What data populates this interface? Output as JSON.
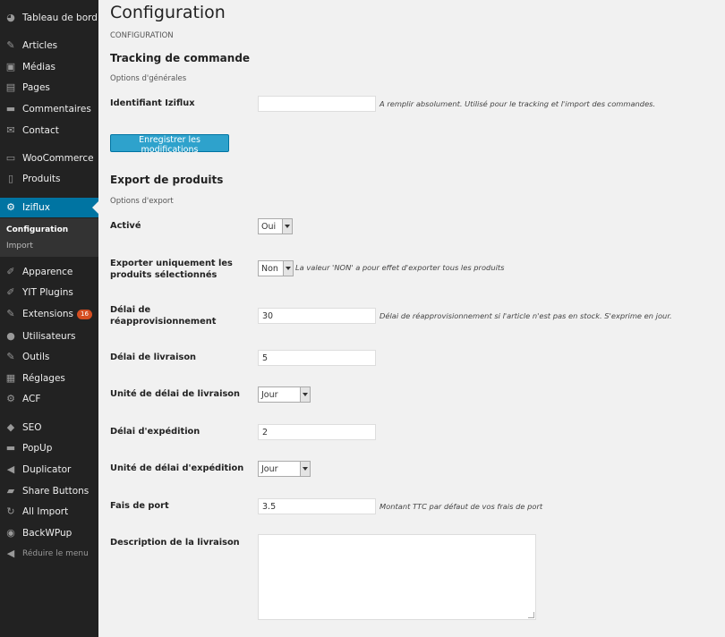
{
  "sidebar": {
    "items": [
      {
        "label": "Tableau de bord",
        "icon": "dashboard-icon",
        "glyph": "◕"
      },
      {
        "label": "Articles",
        "icon": "pin-icon",
        "glyph": "✎"
      },
      {
        "label": "Médias",
        "icon": "media-icon",
        "glyph": "▣"
      },
      {
        "label": "Pages",
        "icon": "pages-icon",
        "glyph": "▤"
      },
      {
        "label": "Commentaires",
        "icon": "comments-icon",
        "glyph": "▬"
      },
      {
        "label": "Contact",
        "icon": "mail-icon",
        "glyph": "✉"
      },
      {
        "label": "WooCommerce",
        "icon": "woocommerce-icon",
        "glyph": "▭"
      },
      {
        "label": "Produits",
        "icon": "products-icon",
        "glyph": "▯"
      },
      {
        "label": "Iziflux",
        "icon": "gear-icon",
        "glyph": "⚙"
      },
      {
        "label": "Apparence",
        "icon": "appearance-icon",
        "glyph": "✐"
      },
      {
        "label": "YIT Plugins",
        "icon": "plugins-icon",
        "glyph": "✐"
      },
      {
        "label": "Extensions",
        "icon": "extensions-icon",
        "glyph": "✎",
        "badge": "16"
      },
      {
        "label": "Utilisateurs",
        "icon": "users-icon",
        "glyph": "●"
      },
      {
        "label": "Outils",
        "icon": "tools-icon",
        "glyph": "✎"
      },
      {
        "label": "Réglages",
        "icon": "settings-icon",
        "glyph": "▦"
      },
      {
        "label": "ACF",
        "icon": "acf-icon",
        "glyph": "⚙"
      },
      {
        "label": "SEO",
        "icon": "seo-icon",
        "glyph": "◆"
      },
      {
        "label": "PopUp",
        "icon": "popup-icon",
        "glyph": "▬"
      },
      {
        "label": "Duplicator",
        "icon": "duplicator-icon",
        "glyph": "◀"
      },
      {
        "label": "Share Buttons",
        "icon": "share-icon",
        "glyph": "▰"
      },
      {
        "label": "All Import",
        "icon": "import-icon",
        "glyph": "↻"
      },
      {
        "label": "BackWPup",
        "icon": "backup-icon",
        "glyph": "◉"
      }
    ],
    "submenu": {
      "configuration": "Configuration",
      "import": "Import"
    },
    "collapse_label": "Réduire le menu"
  },
  "main": {
    "page_title": "Configuration",
    "breadcrumb": "CONFIGURATION",
    "tracking": {
      "title": "Tracking de commande",
      "subtitle": "Options d'générales",
      "id_label": "Identifiant Iziflux",
      "id_value": "",
      "id_desc": "A remplir absolument. Utilisé pour le tracking et l'import des commandes.",
      "save_label": "Enregistrer les modifications"
    },
    "export": {
      "title": "Export de produits",
      "subtitle": "Options d'export",
      "active_label": "Activé",
      "active_value": "Oui",
      "selected_label": "Exporter uniquement les produits sélectionnés",
      "selected_value": "Non",
      "selected_desc": "La valeur 'NON' a pour effet d'exporter tous les produits",
      "restock_label": "Délai de réapprovisionnement",
      "restock_value": "30",
      "restock_desc": "Délai de réapprovisionnement si l'article n'est pas en stock. S'exprime en jour.",
      "delivery_label": "Délai de livraison",
      "delivery_value": "5",
      "delivery_unit_label": "Unité de délai de livraison",
      "delivery_unit_value": "Jour",
      "shipping_label": "Délai d'expédition",
      "shipping_value": "2",
      "shipping_unit_label": "Unité de délai d'expédition",
      "shipping_unit_value": "Jour",
      "port_label": "Fais de port",
      "port_value": "3.5",
      "port_desc": "Montant TTC par défaut de vos frais de port",
      "delivery_desc_label": "Description de la livraison"
    }
  }
}
